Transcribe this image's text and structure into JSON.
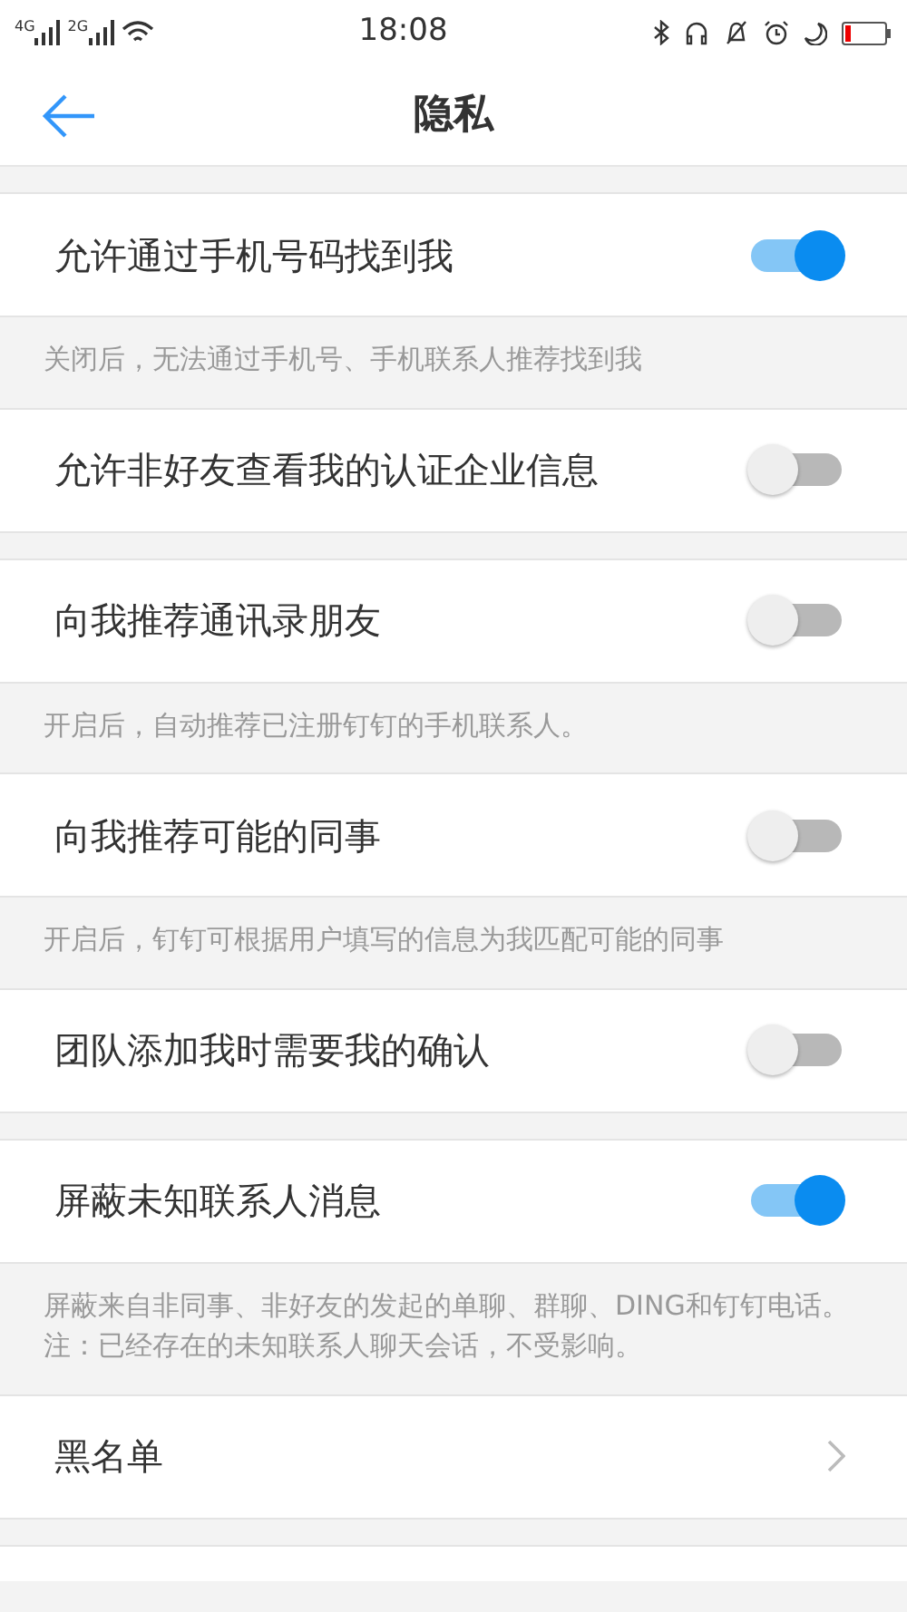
{
  "status_bar": {
    "network_1": "4G",
    "network_2": "2G",
    "time": "18:08"
  },
  "header": {
    "title": "隐私"
  },
  "settings": [
    {
      "kind": "toggle",
      "label": "允许通过手机号码找到我",
      "on": true,
      "note": "关闭后，无法通过手机号、手机联系人推荐找到我"
    },
    {
      "kind": "toggle",
      "label": "允许非好友查看我的认证企业信息",
      "on": false
    },
    {
      "kind": "toggle",
      "label": "向我推荐通讯录朋友",
      "on": false,
      "note": "开启后，自动推荐已注册钉钉的手机联系人。"
    },
    {
      "kind": "toggle",
      "label": "向我推荐可能的同事",
      "on": false,
      "note": "开启后，钉钉可根据用户填写的信息为我匹配可能的同事"
    },
    {
      "kind": "toggle",
      "label": "团队添加我时需要我的确认",
      "on": false
    },
    {
      "kind": "toggle",
      "label": "屏蔽未知联系人消息",
      "on": true,
      "note": "屏蔽来自非同事、非好友的发起的单聊、群聊、DING和钉钉电话。注：已经存在的未知联系人聊天会话，不受影响。"
    },
    {
      "kind": "link",
      "label": "黑名单"
    }
  ]
}
